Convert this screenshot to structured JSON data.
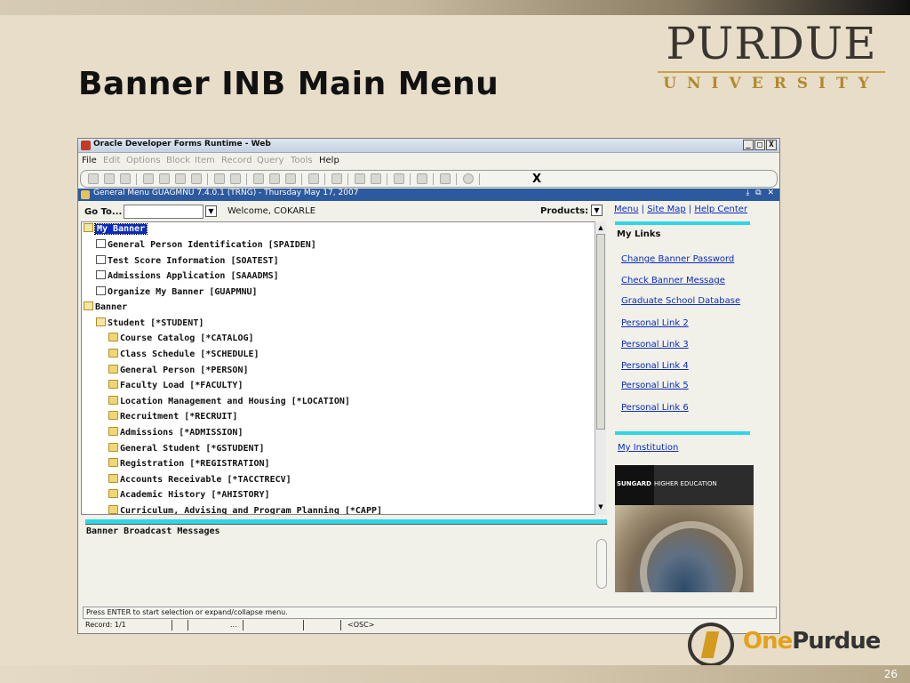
{
  "slide": {
    "title": "Banner INB Main Menu",
    "page_number": "26",
    "logo_main": "PURDUE",
    "logo_sub": "UNIVERSITY",
    "footer_logo_one": "One",
    "footer_logo_purdue": "Purdue"
  },
  "window": {
    "title": "Oracle Developer Forms Runtime - Web",
    "controls": [
      "_",
      "□",
      "X"
    ]
  },
  "menubar": [
    {
      "label": "File",
      "enabled": true
    },
    {
      "label": "Edit",
      "enabled": false
    },
    {
      "label": "Options",
      "enabled": false
    },
    {
      "label": "Block",
      "enabled": false
    },
    {
      "label": "Item",
      "enabled": false
    },
    {
      "label": "Record",
      "enabled": false
    },
    {
      "label": "Query",
      "enabled": false
    },
    {
      "label": "Tools",
      "enabled": false
    },
    {
      "label": "Help",
      "enabled": true
    }
  ],
  "toolbar": {
    "exit_label": "X"
  },
  "form": {
    "title": "General Menu  GUAGMNU  7.4.0.1  (TRNG) - Thursday May 17, 2007",
    "goto_label": "Go To...",
    "goto_value": "",
    "welcome": "Welcome, COKARLE",
    "products_label": "Products:"
  },
  "tree": [
    {
      "label": "My Banner",
      "icon": "open-folder",
      "level": 0,
      "selected": true
    },
    {
      "label": "General Person Identification [SPAIDEN]",
      "icon": "document",
      "level": 1
    },
    {
      "label": "Test Score Information [SOATEST]",
      "icon": "document",
      "level": 1
    },
    {
      "label": "Admissions Application [SAAADMS]",
      "icon": "document",
      "level": 1
    },
    {
      "label": "Organize My Banner [GUAPMNU]",
      "icon": "document",
      "level": 1
    },
    {
      "label": "Banner",
      "icon": "open-folder",
      "level": 0
    },
    {
      "label": "Student [*STUDENT]",
      "icon": "open-folder",
      "level": 1
    },
    {
      "label": "Course Catalog [*CATALOG]",
      "icon": "folder",
      "level": 2
    },
    {
      "label": "Class Schedule [*SCHEDULE]",
      "icon": "folder",
      "level": 2
    },
    {
      "label": "General Person [*PERSON]",
      "icon": "folder",
      "level": 2
    },
    {
      "label": "Faculty Load [*FACULTY]",
      "icon": "folder",
      "level": 2
    },
    {
      "label": "Location Management and Housing [*LOCATION]",
      "icon": "folder",
      "level": 2
    },
    {
      "label": "Recruitment [*RECRUIT]",
      "icon": "folder",
      "level": 2
    },
    {
      "label": "Admissions [*ADMISSION]",
      "icon": "folder",
      "level": 2
    },
    {
      "label": "General Student [*GSTUDENT]",
      "icon": "folder",
      "level": 2
    },
    {
      "label": "Registration [*REGISTRATION]",
      "icon": "folder",
      "level": 2
    },
    {
      "label": "Accounts Receivable [*TACCTRECV]",
      "icon": "folder",
      "level": 2
    },
    {
      "label": "Academic History [*AHISTORY]",
      "icon": "folder",
      "level": 2
    },
    {
      "label": "Curriculum, Advising and Program Planning [*CAPP]",
      "icon": "folder",
      "level": 2
    }
  ],
  "side": {
    "top_links": [
      "Menu",
      "Site Map",
      "Help Center"
    ],
    "my_links_heading": "My Links",
    "my_links": [
      "Change Banner Password",
      "Check Banner Message",
      "Graduate School Database",
      "Personal Link 2",
      "Personal Link 3",
      "Personal Link 4",
      "Personal Link 5",
      "Personal Link 6"
    ],
    "my_institution": "My Institution",
    "ad_brand": "SUNGARD",
    "ad_text": "HIGHER EDUCATION"
  },
  "broadcast": {
    "label": "Banner Broadcast Messages"
  },
  "status": {
    "message": "Press ENTER to start selection or expand/collapse menu.",
    "record": "Record: 1/1",
    "ellipsis": "...",
    "mode": "<OSC>"
  }
}
